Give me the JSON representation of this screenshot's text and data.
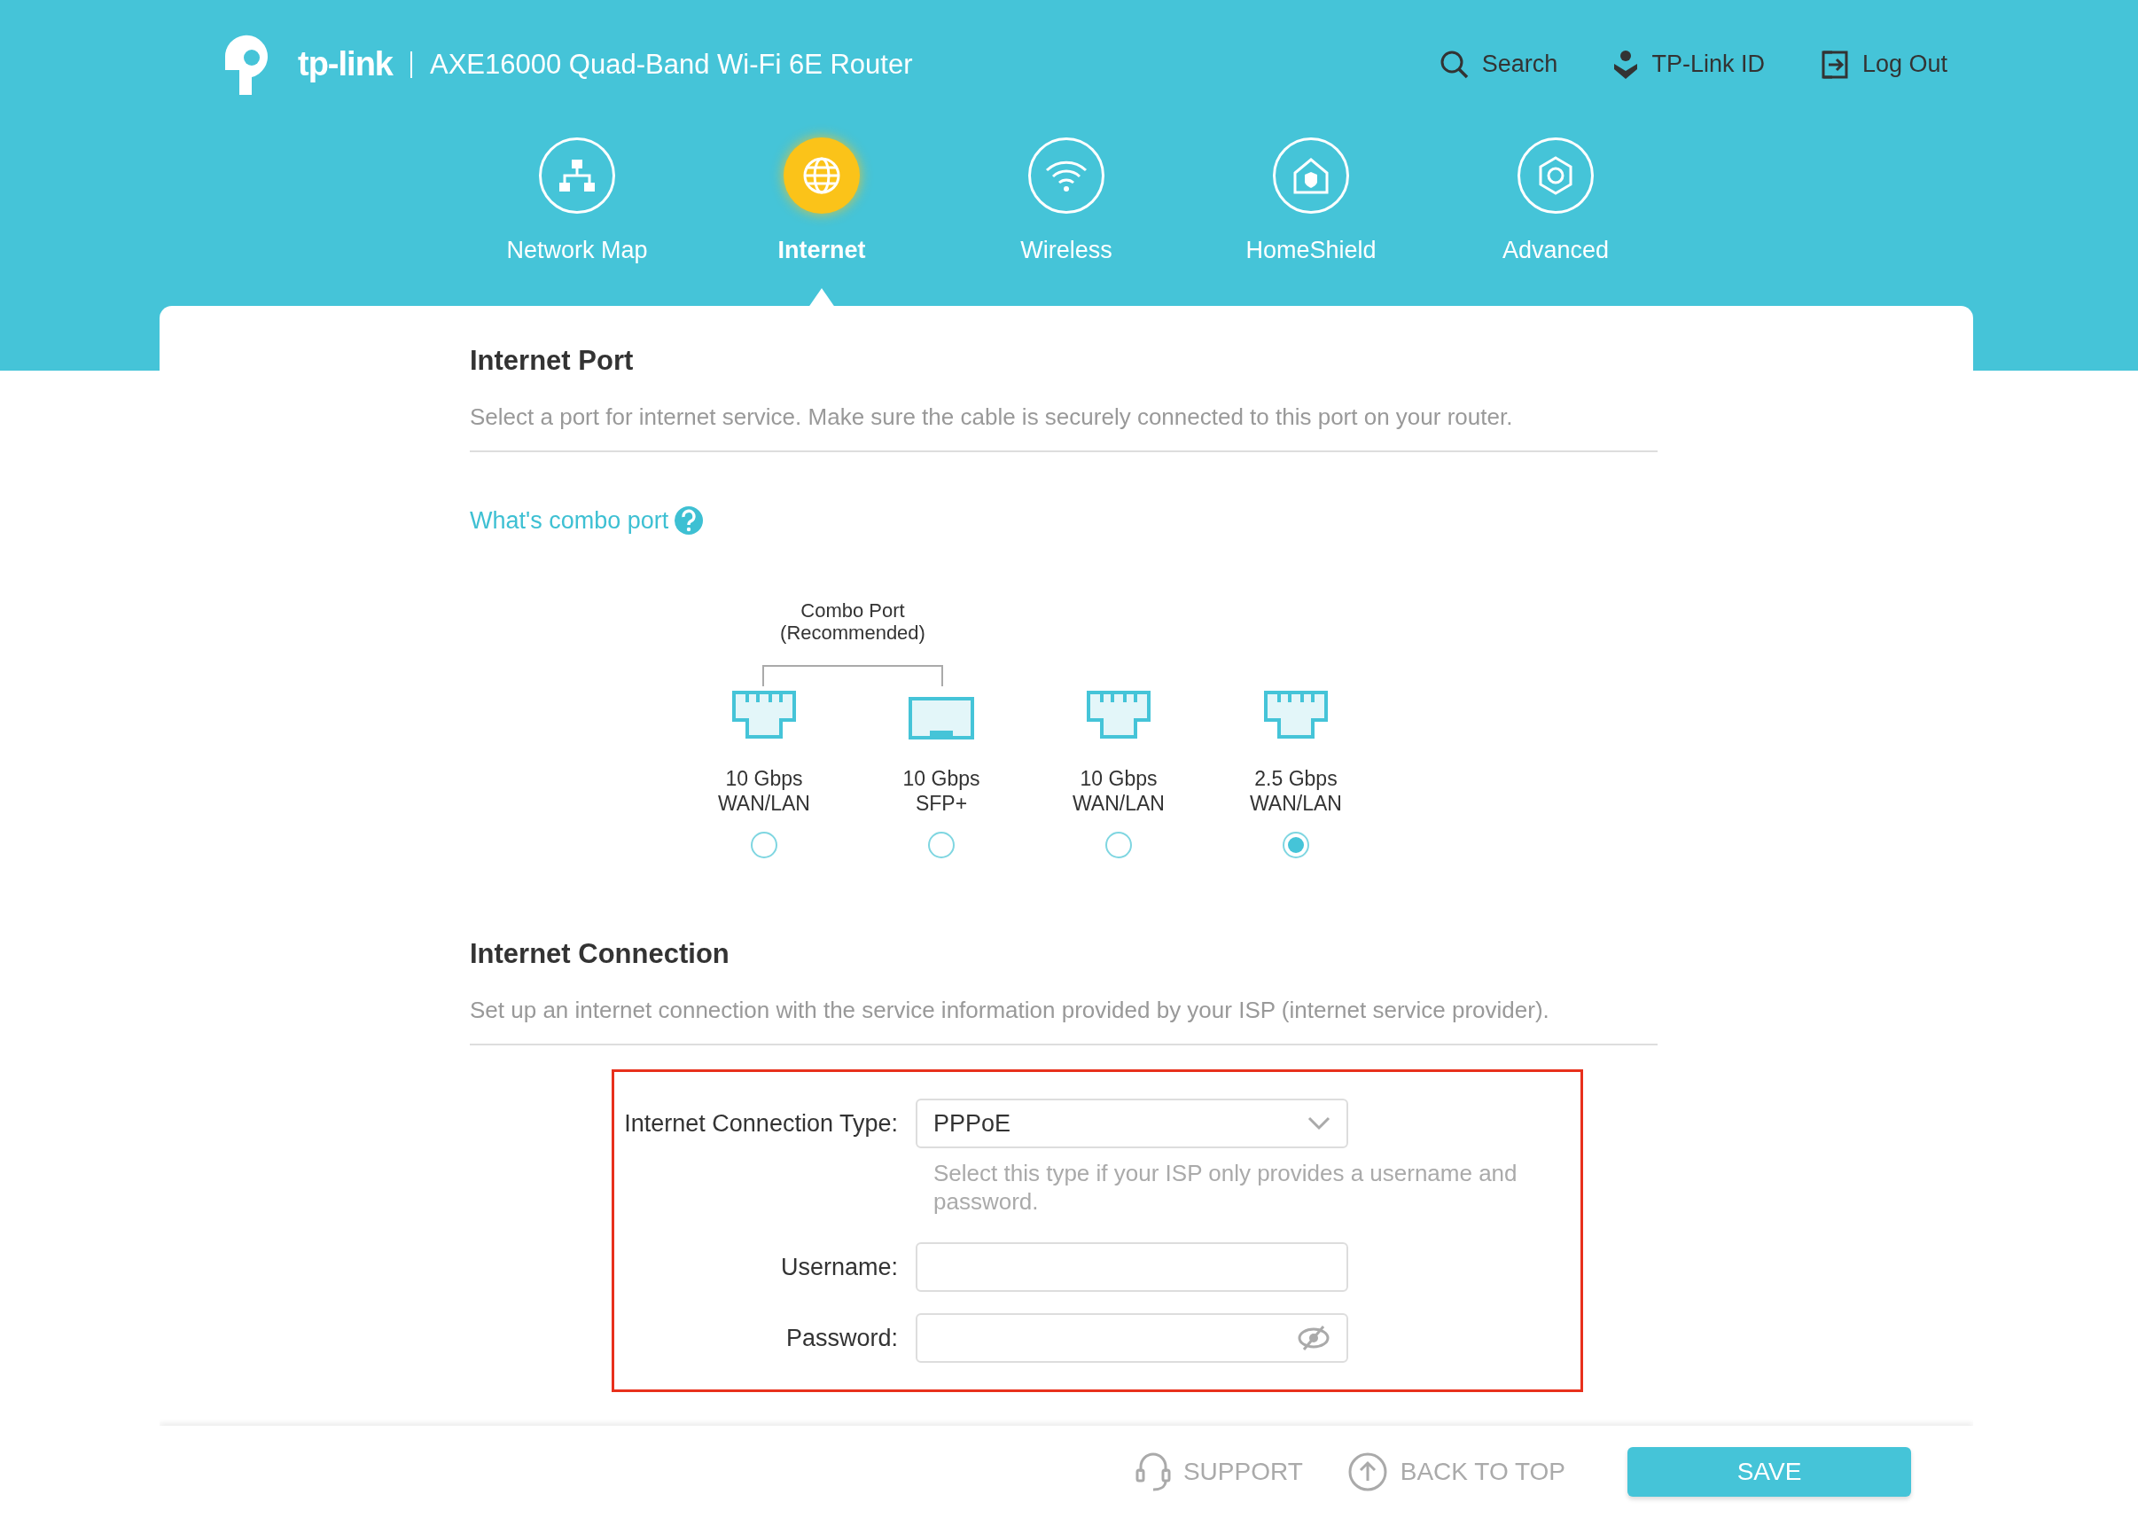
{
  "header": {
    "brand": "tp-link",
    "model": "AXE16000 Quad-Band Wi-Fi 6E Router",
    "links": [
      {
        "kind": "search",
        "label": "Search"
      },
      {
        "kind": "account",
        "label": "TP-Link ID"
      },
      {
        "kind": "logout",
        "label": "Log Out"
      }
    ]
  },
  "nav": [
    {
      "kind": "network",
      "label": "Network Map",
      "selected": false
    },
    {
      "kind": "globe",
      "label": "Internet",
      "selected": true
    },
    {
      "kind": "wifi",
      "label": "Wireless",
      "selected": false
    },
    {
      "kind": "shield",
      "label": "HomeShield",
      "selected": false
    },
    {
      "kind": "gear",
      "label": "Advanced",
      "selected": false
    }
  ],
  "internet_port": {
    "title": "Internet Port",
    "description": "Select a port for internet service. Make sure the cable is securely connected to this port on your router.",
    "help_link": "What's combo port",
    "combo_title": "Combo Port",
    "combo_note": "(Recommended)",
    "ports": [
      {
        "kind": "rj45",
        "speed": "10 Gbps",
        "type": "WAN/LAN",
        "selected": false
      },
      {
        "kind": "sfp",
        "speed": "10 Gbps",
        "type": "SFP+",
        "selected": false
      },
      {
        "kind": "rj45",
        "speed": "10 Gbps",
        "type": "WAN/LAN",
        "selected": false
      },
      {
        "kind": "rj45",
        "speed": "2.5 Gbps",
        "type": "WAN/LAN",
        "selected": true
      }
    ]
  },
  "internet_connection": {
    "title": "Internet Connection",
    "description": "Set up an internet connection with the service information provided by your ISP (internet service provider).",
    "type_label": "Internet Connection Type:",
    "type_value": "PPPoE",
    "type_hint": "Select this type if your ISP only provides a username and password.",
    "username_label": "Username:",
    "password_label": "Password:"
  },
  "footer": {
    "support": "SUPPORT",
    "back_to_top": "BACK TO TOP",
    "save": "SAVE"
  }
}
